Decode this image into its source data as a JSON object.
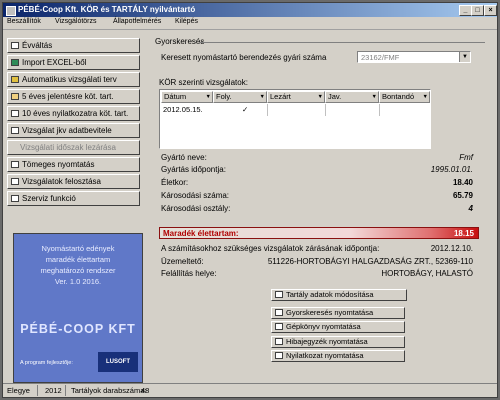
{
  "window": {
    "title": "PÉBÉ-Coop Kft. KÖR és TARTÁLY nyilvántartó",
    "minimize": "_",
    "maximize": "□",
    "close": "×"
  },
  "menu": [
    "Beszállítók",
    "Vizsgálótörzs",
    "Állapotfelmérés",
    "Kilépés"
  ],
  "sidebar": {
    "items": [
      {
        "label": "Évváltás",
        "enabled": true
      },
      {
        "label": "Import EXCEL-ből",
        "enabled": true
      },
      {
        "label": "Automatikus vizsgálati terv",
        "enabled": true
      },
      {
        "label": "5 éves jelentésre köt. tart.",
        "enabled": true
      },
      {
        "label": "10 éves nyilatkozatra köt. tart.",
        "enabled": true
      },
      {
        "label": "Vizsgálat jkv adatbevitele",
        "enabled": true
      },
      {
        "label": "Vizsgálati időszak lezárása",
        "enabled": false
      },
      {
        "label": "Tömeges nyomtatás",
        "enabled": true
      },
      {
        "label": "Vizsgálatok felosztása",
        "enabled": true
      },
      {
        "label": "Szerviz funkció",
        "enabled": true
      }
    ]
  },
  "promo": {
    "lines": [
      "Nyomástartó edények",
      "maradék élettartam",
      "meghatározó rendszer",
      "Ver. 1.0 2016."
    ],
    "logo": "PÉBÉ-COOP KFT",
    "made_by": "A program fejlesztője:",
    "dev_logo": "LUSOFT"
  },
  "search": {
    "section_title": "Gyorskeresés",
    "label": "Keresett nyomástartó berendezés gyári száma",
    "value": "23162/FMF"
  },
  "inspections": {
    "section_title": "KÖR szerinti vizsgálatok:",
    "columns": [
      "Dátum",
      "Foly.",
      "Lezárt",
      "Jav.",
      "Bontandó"
    ],
    "rows": [
      {
        "date": "2012.05.15.",
        "foly": "",
        "lezart": "✓",
        "jav": "",
        "bontando": ""
      }
    ]
  },
  "details": {
    "gyarto_label": "Gyártó neve:",
    "gyarto_value": "Fmf",
    "gyartas_label": "Gyártás időpontja:",
    "gyartas_value": "1995.01.01.",
    "eletkor_label": "Életkor:",
    "eletkor_value": "18.40",
    "karosodasi_szam_label": "Károsodási száma:",
    "karosodasi_szam_value": "65.79",
    "karosodasi_osztaly_label": "Károsodási osztály:",
    "karosodasi_osztaly_value": "4",
    "maradek_label": "Maradék élettartam:",
    "maradek_value": "18.15",
    "szamitas_label": "A számításokhoz szükséges vizsgálatok zárásának időpontja:",
    "szamitas_value": "2012.12.10.",
    "uzemelteto_label": "Üzemeltető:",
    "uzemelteto_value": "511226-HORTOBÁGYI HALGAZDASÁG ZRT., 52369-110",
    "felallitas_label": "Felállítás helye:",
    "felallitas_value": "HORTOBÁGY, HALASTÓ"
  },
  "actions": {
    "modify": "Tartály adatok módosítása",
    "print_search": "Gyorskeresés nyomtatása",
    "print_book": "Gépkönyv nyomtatása",
    "print_errors": "Hibajegyzék nyomtatása",
    "print_statement": "Nyilatkozat nyomtatása"
  },
  "status": {
    "left": "Elegye",
    "year": "2012",
    "count_label": "Tartályok darabszáma:",
    "count_value": "48"
  }
}
